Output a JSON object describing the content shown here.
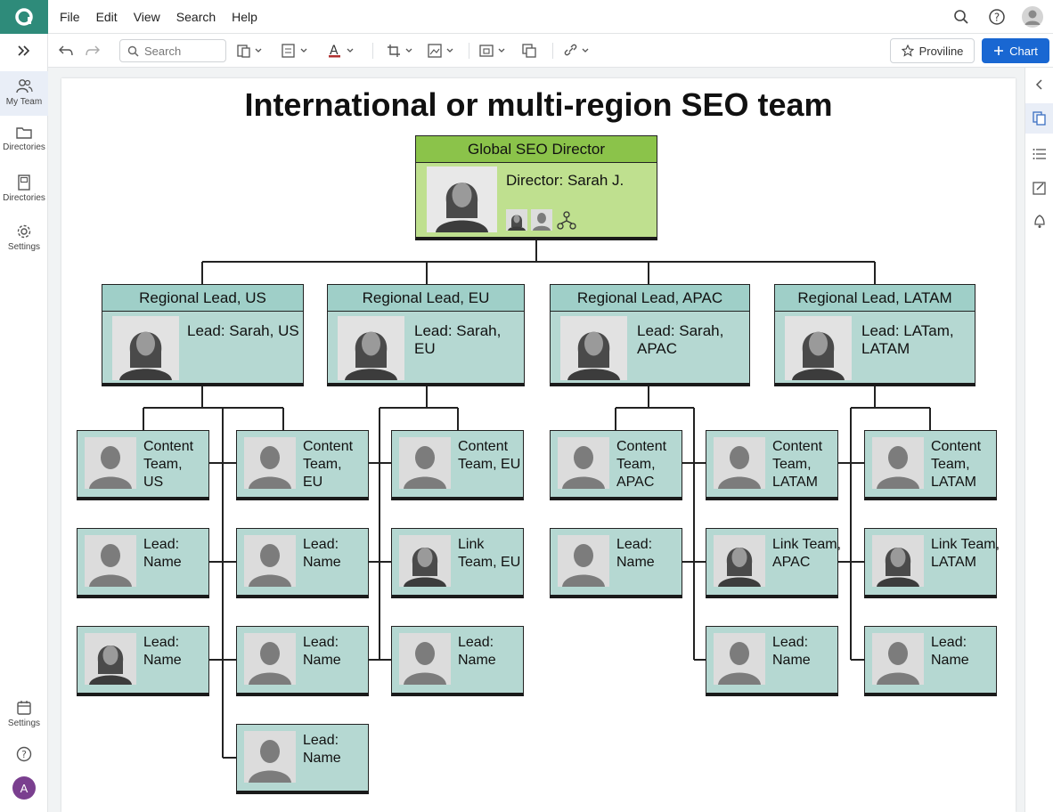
{
  "menu": [
    "File",
    "Edit",
    "View",
    "Search",
    "Help"
  ],
  "sidebar": {
    "items": [
      {
        "label": "My Team"
      },
      {
        "label": "Directories"
      },
      {
        "label": "Directories"
      },
      {
        "label": "Settings"
      }
    ],
    "bottom": {
      "label": "Settings",
      "avatar_letter": "A"
    }
  },
  "toolbar": {
    "search_placeholder": "Search",
    "proviline_label": "Proviline",
    "chart_label": "Chart"
  },
  "chart": {
    "title": "International or multi-region SEO team",
    "director": {
      "header": "Global SEO Director",
      "text": "Director: Sarah J."
    },
    "regions": [
      {
        "header": "Regional Lead, US",
        "text": "Lead: Sarah, US"
      },
      {
        "header": "Regional Lead, EU",
        "text": "Lead: Sarah, EU"
      },
      {
        "header": "Regional Lead, APAC",
        "text": "Lead: Sarah, APAC"
      },
      {
        "header": "Regional Lead, LATAM",
        "text": "Lead: LATam, LATAM"
      }
    ],
    "teams": {
      "us_left": [
        "Content Team, US",
        "Lead: Name",
        "Lead: Name"
      ],
      "us_right": [
        "Content Team, EU",
        "Lead: Name",
        "Lead: Name",
        "Lead: Name"
      ],
      "eu": [
        "Content Team, EU",
        "Link Team, EU",
        "Lead: Name"
      ],
      "apac_left": [
        "Content Team, APAC",
        "Lead: Name"
      ],
      "apac_right": [
        "Content Team, LATAM",
        "Link Team, APAC",
        "Lead: Name"
      ],
      "latam": [
        "Content Team, LATAM",
        "Link Team, LATAM",
        "Lead: Name"
      ]
    }
  }
}
